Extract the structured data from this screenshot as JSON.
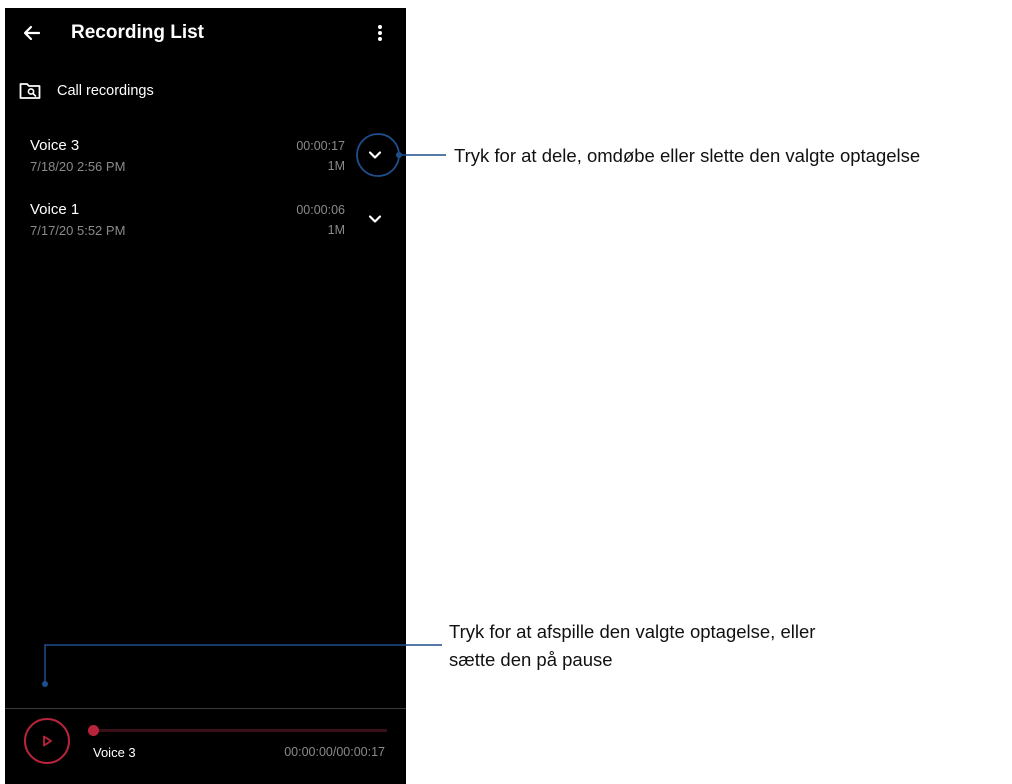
{
  "header": {
    "title": "Recording List",
    "back_icon": "arrow-left-icon",
    "menu_icon": "more-vert-icon"
  },
  "call_recordings": {
    "label": "Call recordings",
    "icon": "folder-search-icon"
  },
  "recordings": [
    {
      "name": "Voice 3",
      "date": "7/18/20 2:56 PM",
      "duration": "00:00:17",
      "size": "1M",
      "highlighted": true
    },
    {
      "name": "Voice 1",
      "date": "7/17/20 5:52 PM",
      "duration": "00:00:06",
      "size": "1M",
      "highlighted": false
    }
  ],
  "player": {
    "title": "Voice 3",
    "time": "00:00:00/00:00:17",
    "progress": 0,
    "accent": "#b8243c"
  },
  "annotations": {
    "expand": "Tryk for at dele, omdøbe eller slette den valgte optagelse",
    "play_line1": "Tryk for at afspille den valgte optagelse, eller",
    "play_line2": "sætte den på pause"
  },
  "colors": {
    "screen_bg": "#000000",
    "callout": "#1f4e8c",
    "secondary_text": "#8a8a8a"
  }
}
